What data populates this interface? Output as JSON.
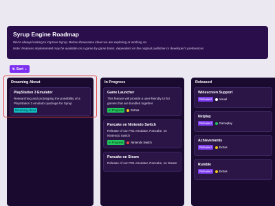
{
  "header": {
    "title": "Syrup Engine Roadmap",
    "subtitle": "We're always looking to improve Syrup. Below showcases ideas we are exploring or working on.",
    "note": "Note: Features implemented may be available on a game by game basis, dependent on the original publisher or developer's preferences"
  },
  "sort": {
    "label": "Sort",
    "icon": "sort-arrows-icon"
  },
  "colors": {
    "header_bg": "#2a0e4c",
    "column_bg": "#1a0a30",
    "accent": "#7c2ff0",
    "highlight": "#e04848",
    "dreaming_badge": "#10c0c0",
    "in_progress_badge": "#22c55e",
    "released_badge": "#7c3aed"
  },
  "columns": {
    "dreaming": {
      "title": "Dreaming About",
      "cards": [
        {
          "title": "PlayStation 3 Emulator",
          "description": "Researching and prototyping the possibility of a PlayStation 3 emulator package for Syrup",
          "status": "Dreaming About"
        }
      ]
    },
    "progress": {
      "title": "In Progress",
      "cards": [
        {
          "title": "Game Launcher",
          "description": "This feature will provide a user-friendly UI for games that are bundled together",
          "status": "In Progress",
          "tag": "Extras",
          "tag_color": "#f5c518"
        },
        {
          "title": "Pancake on Nintendo Switch",
          "description": "Release of our PS1 emulator, Pancake, on Nintendo Switch",
          "status": "In Progress",
          "tag": "Nintendo Switch",
          "tag_color": "#ef4444"
        },
        {
          "title": "Pancake on Steam",
          "description": "Release of our PS1 emulator, Pancake, on Steam"
        }
      ]
    },
    "released": {
      "title": "Released",
      "cards": [
        {
          "title": "Widescreen Support",
          "status": "Released",
          "tag": "Visual",
          "tag_color": "#ffffff"
        },
        {
          "title": "Netplay",
          "status": "Released",
          "tag": "Gameplay",
          "tag_color": "#22c55e"
        },
        {
          "title": "Achievements",
          "status": "Released",
          "tag": "Extras",
          "tag_color": "#f5c518"
        },
        {
          "title": "Rumble",
          "status": "Released",
          "tag": "Extras",
          "tag_color": "#f5c518"
        }
      ]
    }
  }
}
